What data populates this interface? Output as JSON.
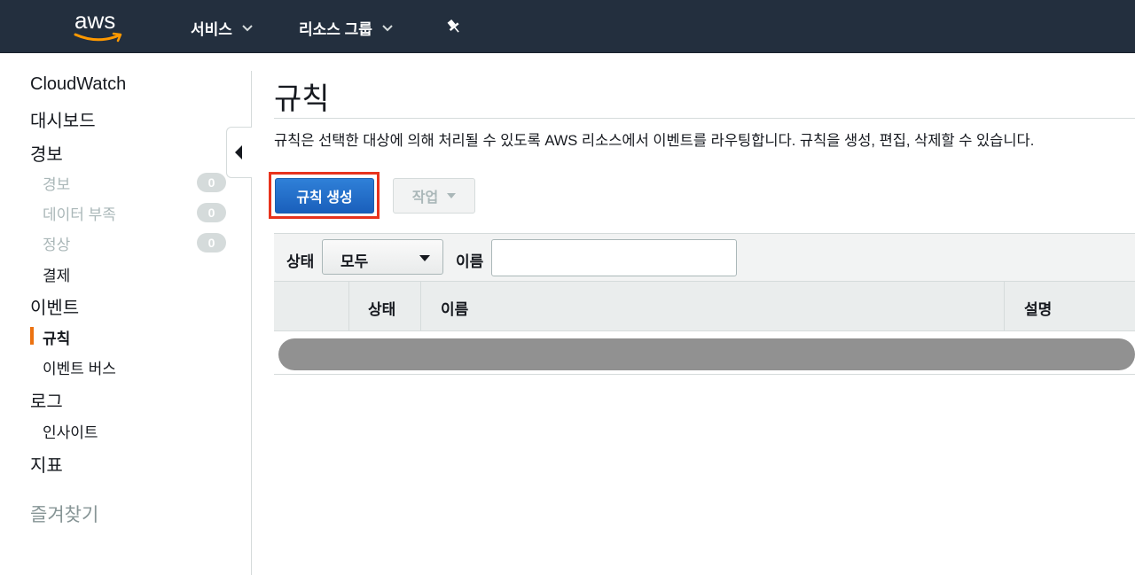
{
  "topnav": {
    "logo_text": "aws",
    "services_label": "서비스",
    "resource_groups_label": "리소스 그룹",
    "pin_icon": "pushpin-icon"
  },
  "sidebar": {
    "app_title": "CloudWatch",
    "dashboards": "대시보드",
    "alarms": "경보",
    "alarm_states": [
      {
        "label": "경보",
        "count": "0"
      },
      {
        "label": "데이터 부족",
        "count": "0"
      },
      {
        "label": "정상",
        "count": "0"
      }
    ],
    "billing": "결제",
    "events": "이벤트",
    "rules": "규칙",
    "event_buses": "이벤트 버스",
    "logs": "로그",
    "insights": "인사이트",
    "metrics": "지표",
    "favorites": "즐겨찾기"
  },
  "main": {
    "title": "규칙",
    "description": "규칙은 선택한 대상에 의해 처리될 수 있도록 AWS 리소스에서 이벤트를 라우팅합니다. 규칙을 생성, 편집, 삭제할 수 있습니다.",
    "create_rule_button": "규칙 생성",
    "actions_button": "작업",
    "filter": {
      "status_label": "상태",
      "status_value": "모두",
      "name_label": "이름",
      "name_value": ""
    },
    "table": {
      "columns": [
        "상태",
        "이름",
        "설명"
      ]
    }
  },
  "colors": {
    "topbar": "#232f3e",
    "primary_button": "#1a5fbb",
    "active_indicator": "#ec7211",
    "highlight": "#e8331d"
  }
}
